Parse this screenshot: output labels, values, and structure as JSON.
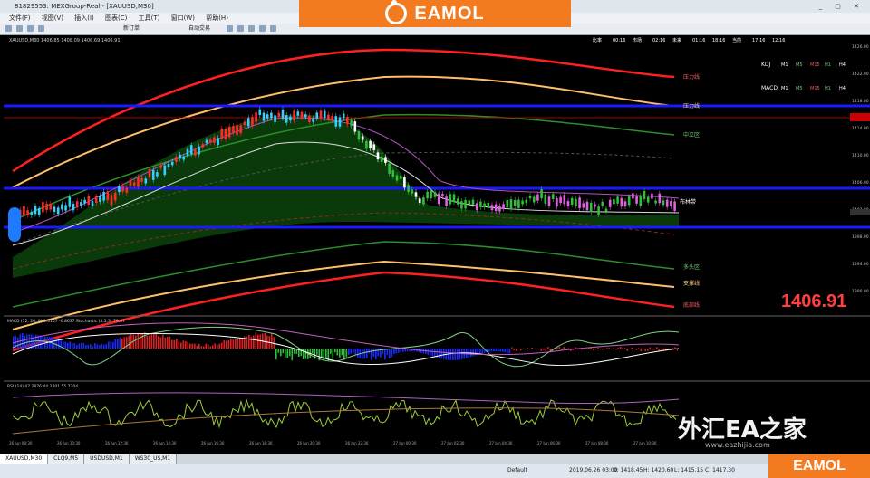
{
  "window": {
    "title": "81829553: MEXGroup-Real - [XAUUSD,M30]",
    "controls": "_ ▢ ✕"
  },
  "menu": [
    "文件(F)",
    "视图(V)",
    "插入(I)",
    "图表(C)",
    "工具(T)",
    "窗口(W)",
    "帮助(H)"
  ],
  "toolbar": {
    "new_order": "新订单",
    "autotrading": "自动交易"
  },
  "brand": {
    "name": "EAMOL"
  },
  "chart": {
    "symbol_info": "XAUUSD,M30 1406.85 1408.09 1406.69 1406.91",
    "countdown_labels": [
      "比率",
      "00:16",
      "市场",
      "02:16",
      "未来",
      "01:16",
      "18:16",
      "当前",
      "17:16",
      "12:16"
    ],
    "right_labels": [
      "压力线",
      "压力线",
      "中立区",
      "布林带",
      "多头区",
      "支撑线",
      "底部线"
    ],
    "price_big": "1406.91",
    "indicator_legend": [
      {
        "name": "KDJ",
        "cols": [
          "M1",
          "M5",
          "M15",
          "H1",
          "H4"
        ]
      },
      {
        "name": "MACD",
        "cols": [
          "M1",
          "M5",
          "M15",
          "H1",
          "H4"
        ]
      }
    ],
    "macd_caption": "MACD (12, 26, 9) 0.3157 -0.8637  Stochastic (5,3,3) 79.87",
    "rsi_caption": "RSI (14) 47.2876  44.2401  55.7304",
    "time_axis": [
      "26 Jun 08:30",
      "26 Jun 10:30",
      "26 Jun 12:30",
      "26 Jun 14:30",
      "26 Jun 16:30",
      "26 Jun 18:30",
      "26 Jun 20:30",
      "26 Jun 22:30",
      "27 Jun 00:30",
      "27 Jun 02:30",
      "27 Jun 04:30",
      "27 Jun 06:30",
      "27 Jun 08:30",
      "27 Jun 10:30"
    ],
    "price_axis": [
      "1426.00",
      "1422.00",
      "1418.00",
      "1414.00",
      "1410.00",
      "1406.00",
      "1402.00",
      "1398.00",
      "1394.00",
      "1390.00"
    ],
    "colors": {
      "up": "#ff2a2a",
      "down": "#36d0ff",
      "blue_line": "#1a1aff",
      "band_red": "#ff2020",
      "band_orange": "#ffbf6a"
    }
  },
  "tabs": [
    "XAUUSD,M30",
    "CLQ9,M5",
    "USDUSD,M1",
    "WS30_US,M1"
  ],
  "status": {
    "profile": "Default",
    "time": "2019.06.26 03:00",
    "o": "O: 1418.45",
    "h": "H: 1420.60",
    "l": "L: 1415.15",
    "c": "C: 1417.30"
  },
  "watermark": {
    "text": "外汇EA之家",
    "sub": "www.eazhijia.com"
  }
}
